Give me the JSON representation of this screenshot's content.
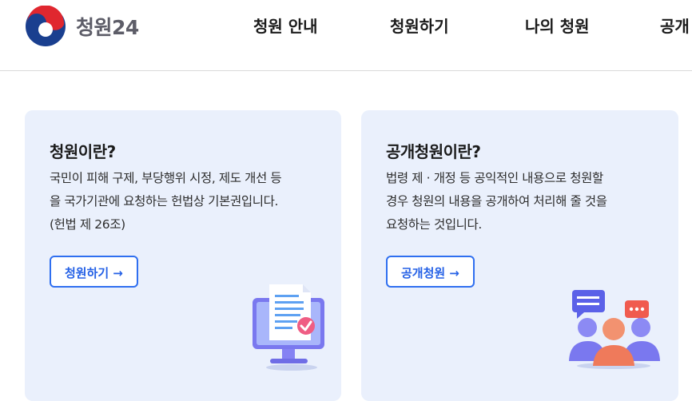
{
  "header": {
    "logo_text": "청원24",
    "nav": [
      "청원 안내",
      "청원하기",
      "나의 청원",
      "공개"
    ]
  },
  "cards": [
    {
      "title": "청원이란?",
      "lines": [
        "국민이 피해 구제, 부당행위 시정, 제도 개선 등",
        "을 국가기관에 요청하는 헌법상 기본권입니다.",
        "(헌법 제 26조)"
      ],
      "button": "청원하기",
      "icon": "document-monitor-check-icon"
    },
    {
      "title": "공개청원이란?",
      "lines": [
        "법령 제 · 개정 등 공익적인 내용으로 청원할",
        "경우 청원의 내용을 공개하여 처리해 줄 것을",
        "요청하는 것입니다."
      ],
      "button": "공개청원",
      "icon": "people-chat-icon"
    }
  ],
  "arrow": "→",
  "colors": {
    "card_bg": "#eaf0fc",
    "accent": "#2f6ff0",
    "taeguk_red": "#e0272f",
    "taeguk_blue": "#1a3f8f"
  }
}
